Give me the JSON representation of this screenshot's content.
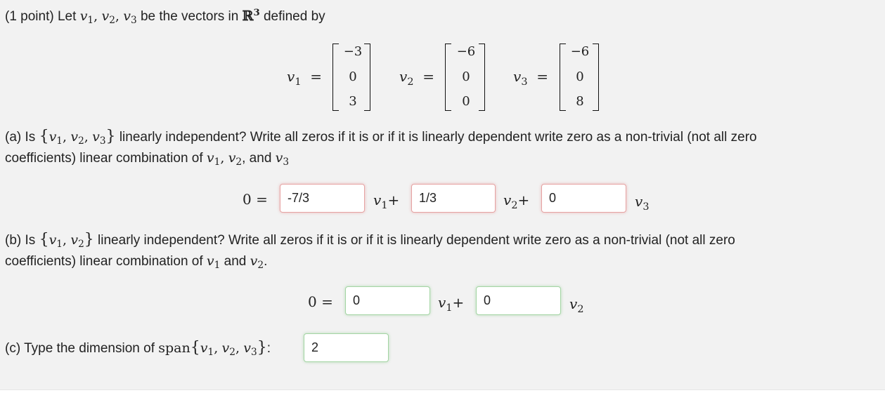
{
  "problem": {
    "points": "(1 point) Let",
    "intro_tail": "be the vectors in",
    "defined_by": "defined by",
    "v1": "v",
    "v1_sub": "1",
    "v2": "v",
    "v2_sub": "2",
    "v3": "v",
    "v3_sub": "3",
    "R": "ℝ",
    "R_exp": "3",
    "vectors": [
      {
        "label": "v",
        "sub": "1",
        "entries": [
          "−3",
          "0",
          "3"
        ]
      },
      {
        "label": "v",
        "sub": "2",
        "entries": [
          "−6",
          "0",
          "0"
        ]
      },
      {
        "label": "v",
        "sub": "3",
        "entries": [
          "−6",
          "0",
          "8"
        ]
      }
    ],
    "equals": "=",
    "comma": ",",
    "lbrace": "{",
    "rbrace": "}"
  },
  "part_a": {
    "prefix": "(a) Is",
    "question": "linearly independent? Write all zeros if it is or if it is linearly dependent write zero as a non-trivial (not all zero",
    "line2_prefix": "coefficients) linear combination of",
    "line2_and": ", and",
    "zero": "0",
    "plus": "+",
    "inputs": [
      {
        "value": "-7/3",
        "status": "incorrect"
      },
      {
        "value": "1/3",
        "status": "incorrect"
      },
      {
        "value": "0",
        "status": "incorrect"
      }
    ]
  },
  "part_b": {
    "prefix": "(b) Is",
    "question": "linearly independent? Write all zeros if it is or if it is linearly dependent write zero as a non-trivial (not all zero",
    "line2_prefix": "coefficients) linear combination of",
    "line2_and": "and",
    "period": ".",
    "zero": "0",
    "plus": "+",
    "inputs": [
      {
        "value": "0",
        "status": "correct"
      },
      {
        "value": "0",
        "status": "correct"
      }
    ]
  },
  "part_c": {
    "prefix": "(c) Type the dimension of",
    "span": "span",
    "colon": ":",
    "input": {
      "value": "2",
      "status": "correct"
    }
  },
  "colors": {
    "panel_bg": "#f2f2f2",
    "incorrect_border": "#e6a3a3",
    "correct_border": "#a3d4a3"
  }
}
